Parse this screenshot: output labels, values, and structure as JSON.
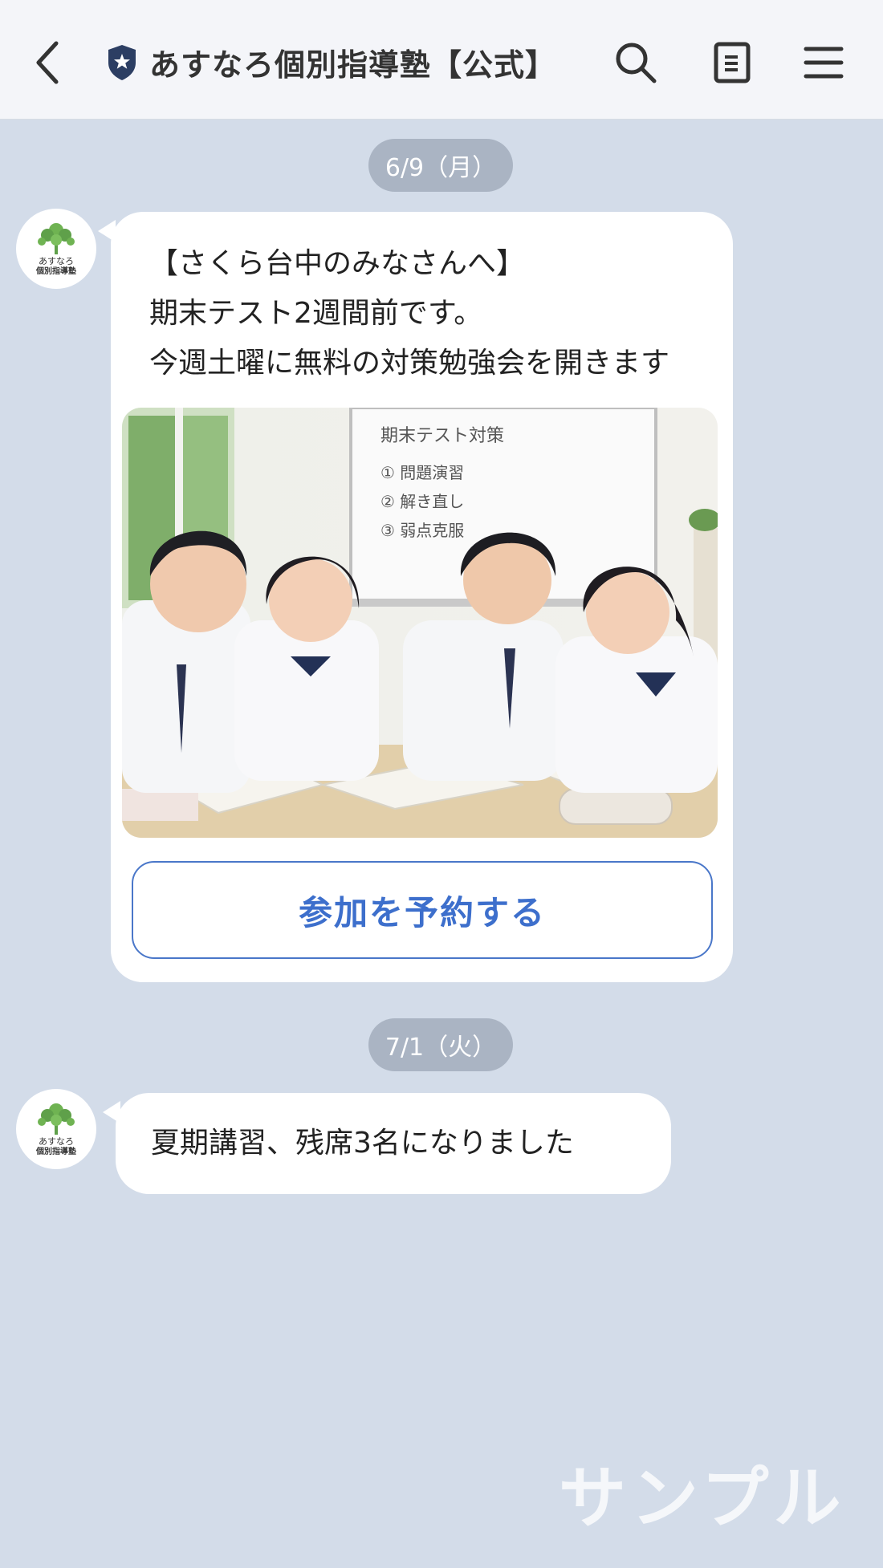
{
  "header": {
    "back_icon": "chevron-left-icon",
    "account_badge_icon": "shield-star-icon",
    "title": "あすなろ個別指導塾【公式】",
    "search_icon": "search-icon",
    "notes_icon": "note-icon",
    "menu_icon": "hamburger-menu-icon"
  },
  "avatar": {
    "line1": "あすなろ",
    "line2": "個別指導塾",
    "icon": "tree-logo-icon"
  },
  "messages": [
    {
      "date": "6/9（月）",
      "lines": [
        "【さくら台中のみなさんへ】",
        "期末テスト2週間前です。",
        "今週土曜に無料の対策勉強会を開きます"
      ],
      "image": {
        "alt": "students studying photo",
        "whiteboard_title": "期末テスト対策",
        "whiteboard_items": [
          "① 問題演習",
          "② 解き直し",
          "③ 弱点克服"
        ]
      },
      "button_label": "参加を予約する"
    },
    {
      "date": "7/1（火）",
      "lines": [
        "夏期講習、残席3名になりました"
      ]
    }
  ],
  "watermark": "サンプル",
  "colors": {
    "background": "#d3dce9",
    "header": "#f4f5f9",
    "date_pill": "#aab4c3",
    "button_accent": "#3d6fcc",
    "shield": "#2c3e63",
    "logo_green": "#5fa04a"
  }
}
